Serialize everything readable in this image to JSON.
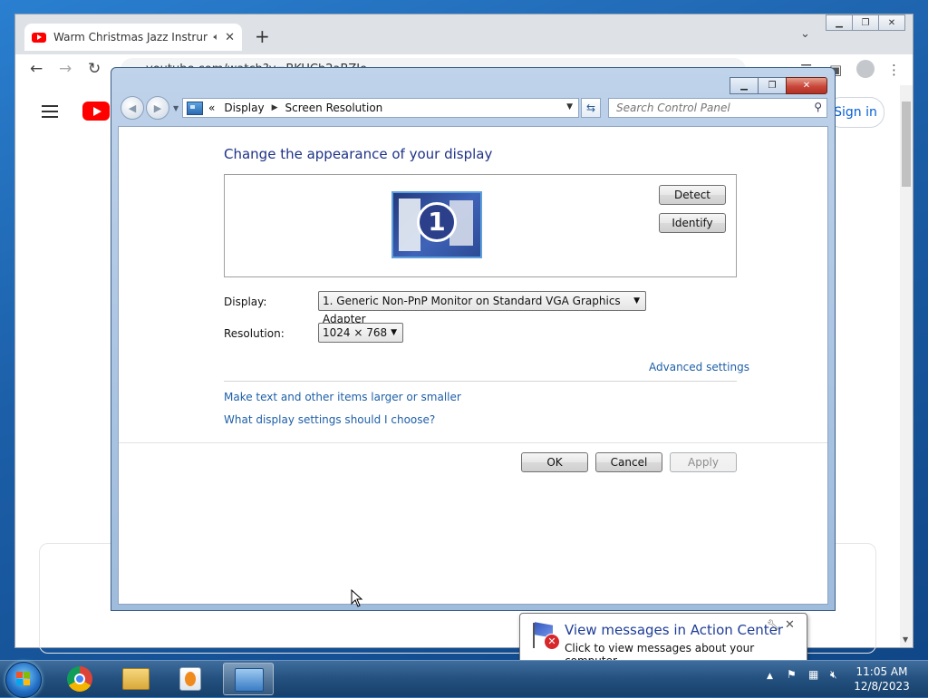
{
  "browser": {
    "tab_title": "Warm Christmas Jazz Instrum",
    "address": "youtube.com/watch?v=BKUCh2aBZJo",
    "signin_label": "Sign in",
    "icons": [
      "back-arrow-icon",
      "forward-arrow-icon",
      "reload-icon",
      "menu-icon",
      "youtube-logo"
    ]
  },
  "window": {
    "breadcrumb_prefix": "«",
    "breadcrumbs": [
      "Display",
      "Screen Resolution"
    ],
    "search_placeholder": "Search Control Panel",
    "title": "Change the appearance of your display",
    "monitor_number": "1",
    "detect_label": "Detect",
    "identify_label": "Identify",
    "display_label": "Display:",
    "display_value": "1. Generic Non-PnP Monitor on Standard VGA Graphics Adapter",
    "resolution_label": "Resolution:",
    "resolution_value": "1024 × 768",
    "advanced_link": "Advanced settings",
    "text_size_link": "Make text and other items larger or smaller",
    "help_link": "What display settings should I choose?",
    "ok_label": "OK",
    "cancel_label": "Cancel",
    "apply_label": "Apply"
  },
  "notification": {
    "title": "View messages in Action Center",
    "body": "Click to view messages about your computer."
  },
  "taskbar": {
    "time": "11:05 AM",
    "date": "12/8/2023"
  },
  "colors": {
    "link": "#1e5fa8",
    "title": "#1e3287",
    "youtube_red": "#ff0000",
    "window_frame": "#a9c3e2"
  }
}
